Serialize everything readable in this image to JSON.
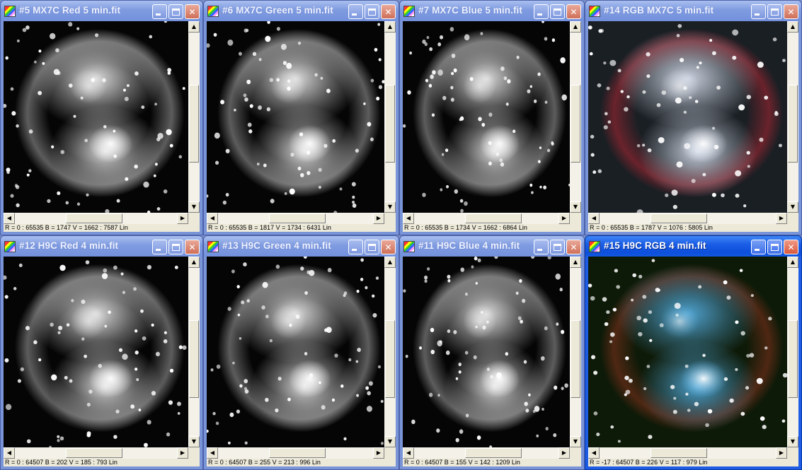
{
  "windows": [
    {
      "title": "#5 MX7C Red 5 min.fit",
      "status": "R = 0 : 65535    B = 1747    V = 1662 : 7587 Lin",
      "tint": "#ffffff",
      "glow": "#ffffff",
      "active": false
    },
    {
      "title": "#6 MX7C Green 5 min.fit",
      "status": "R = 0 : 65535    B = 1817    V = 1734 : 6431 Lin",
      "tint": "#ffffff",
      "glow": "#ffffff",
      "active": false
    },
    {
      "title": "#7 MX7C Blue 5 min.fit",
      "status": "R = 0 : 65535    B = 1734    V = 1662 : 6864 Lin",
      "tint": "#ffffff",
      "glow": "#ffffff",
      "active": false
    },
    {
      "title": "#14 RGB MX7C 5 min.fit",
      "status": "R = 0 : 65535    B = 1787    V = 1076 : 5805 Lin",
      "tint": "#e8f0ff",
      "glow": "#ff2a3a",
      "active": false
    },
    {
      "title": "#12 H9C Red 4 min.fit",
      "status": "R = 0 : 64507    B = 202    V = 185 : 793 Lin",
      "tint": "#ffffff",
      "glow": "#ffffff",
      "active": false
    },
    {
      "title": "#13 H9C Green 4 min.fit",
      "status": "R = 0 : 64507    B = 255    V = 213 : 996 Lin",
      "tint": "#ffffff",
      "glow": "#ffffff",
      "active": false
    },
    {
      "title": "#11 H9C Blue 4 min.fit",
      "status": "R = 0 : 64507    B = 155    V = 142 : 1209 Lin",
      "tint": "#ffffff",
      "glow": "#ffffff",
      "active": false
    },
    {
      "title": "#15 H9C RGB 4 min.fit",
      "status": "R = -17 : 64507    B = 226    V = 117 : 979 Lin",
      "tint": "#5ab8f0",
      "glow": "#c84028",
      "active": true
    }
  ],
  "icons": {
    "app": "astro-image-icon",
    "minimize": "minimize-icon",
    "maximize": "maximize-icon",
    "close": "close-icon"
  },
  "colors": {
    "active_title": "#0d4fdb",
    "inactive_title": "#7f9be0",
    "close_button": "#d9583c"
  }
}
